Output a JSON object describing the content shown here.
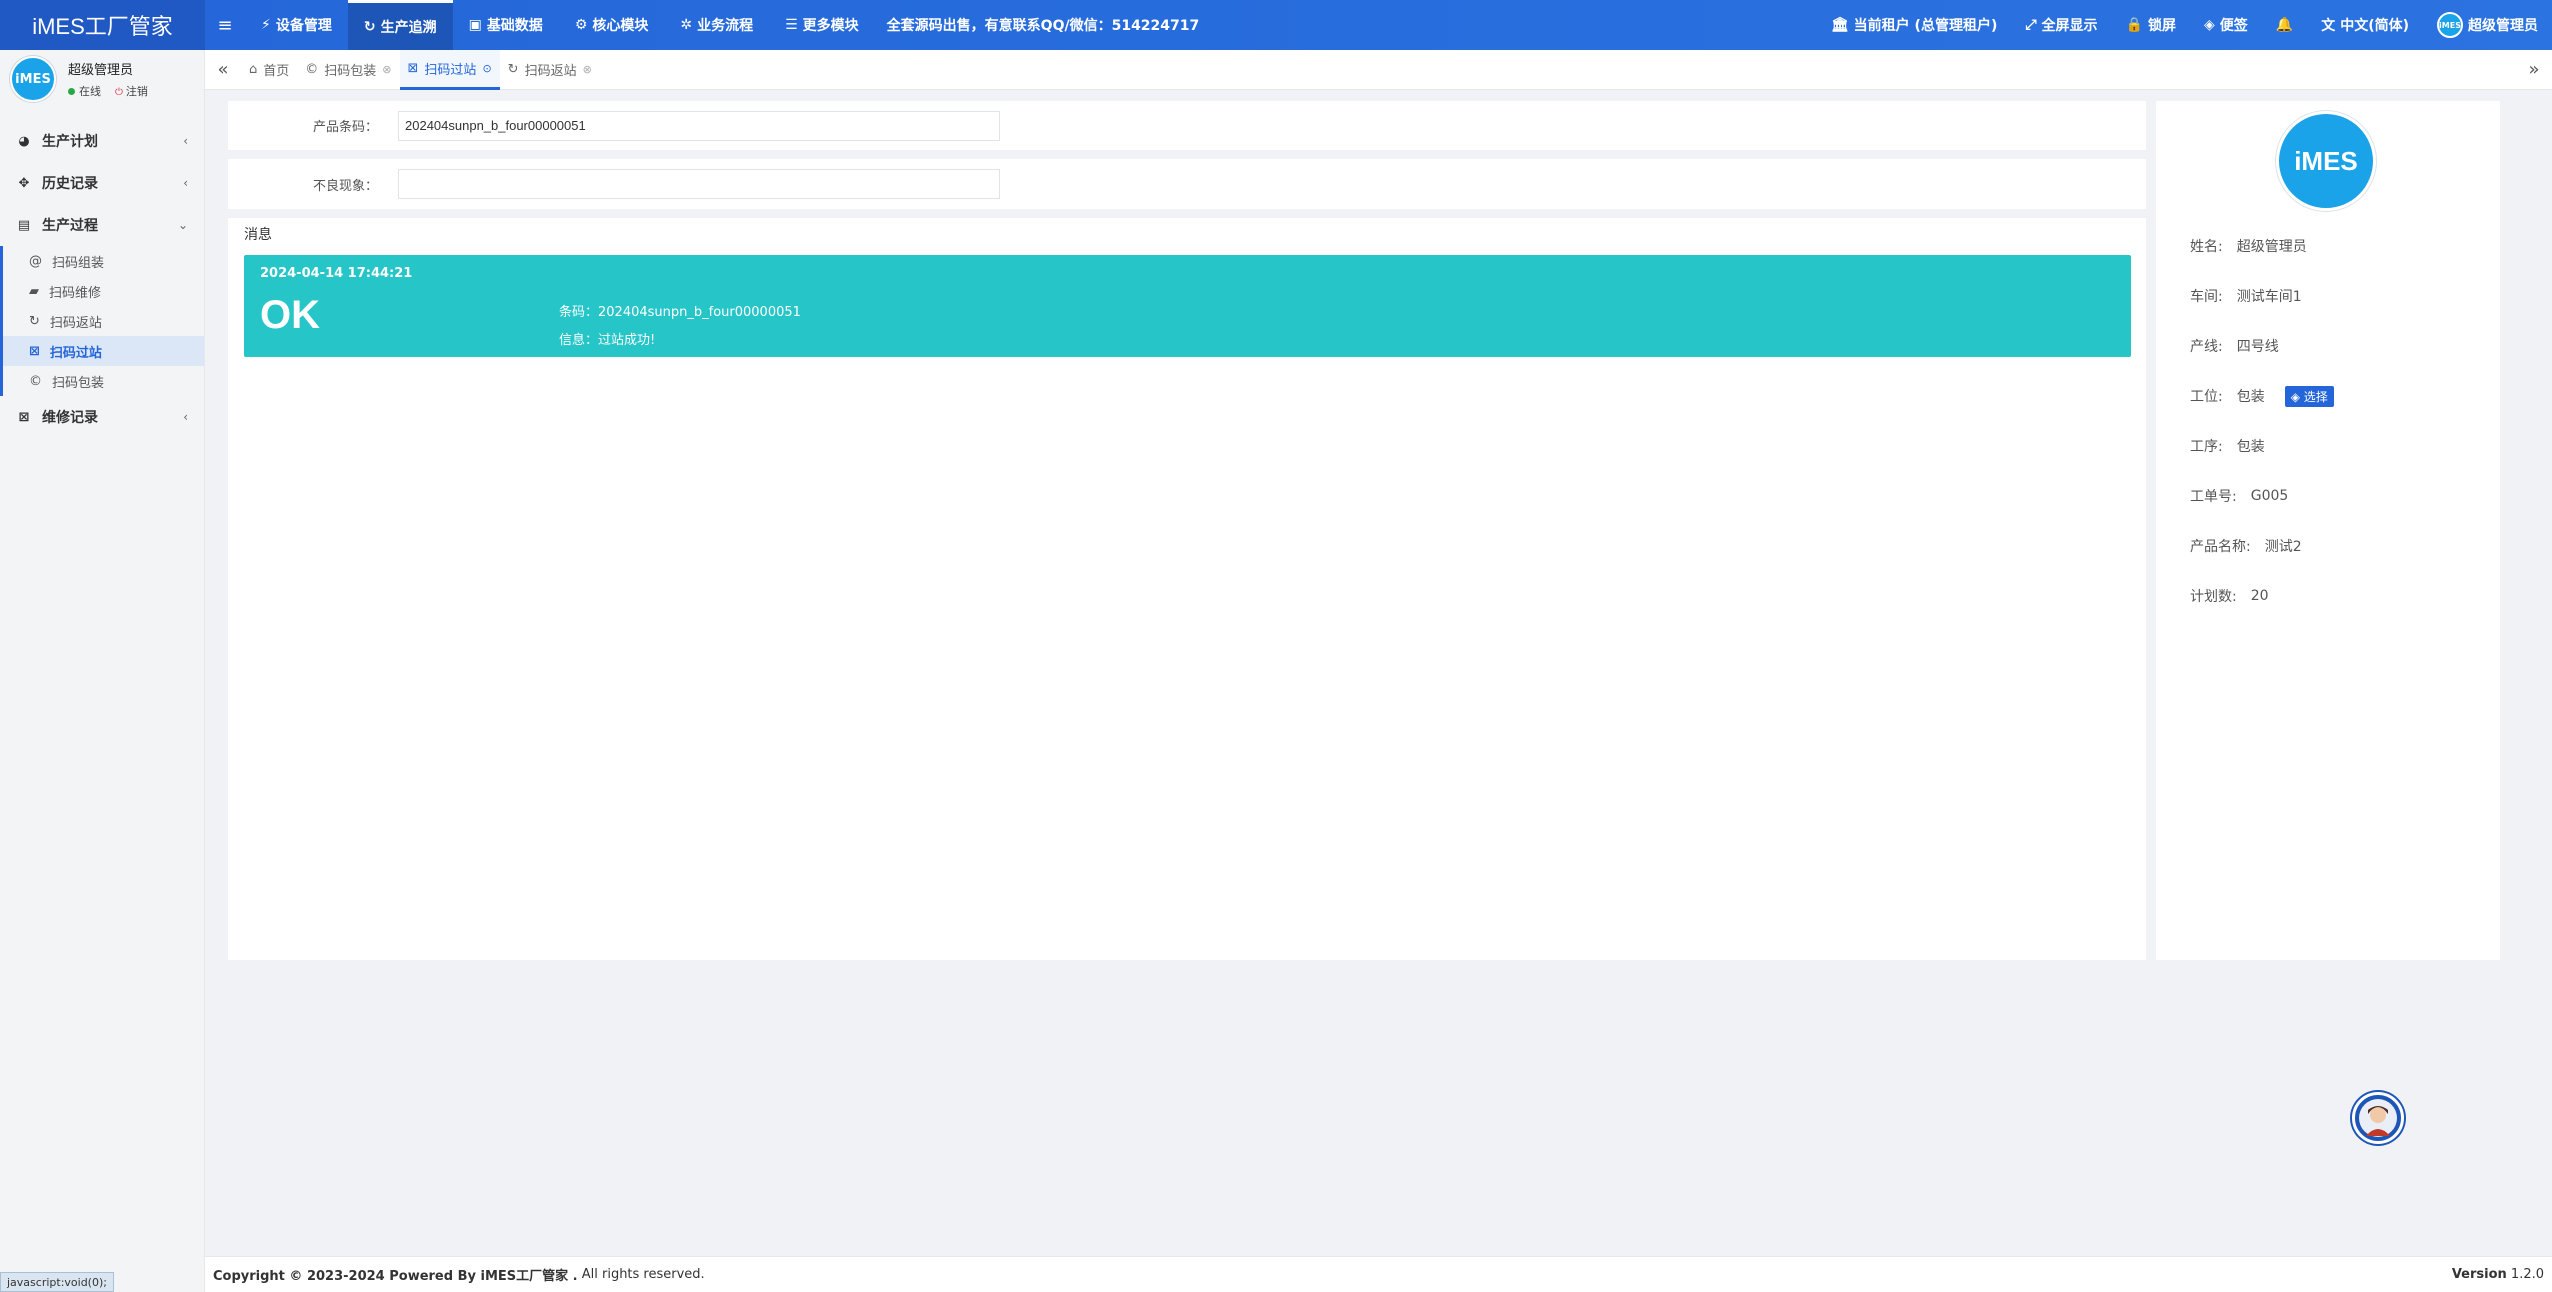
{
  "app": {
    "brand": "iMES工厂管家"
  },
  "topnav": {
    "items": [
      {
        "icon": "wrench-icon",
        "glyph": "⚡",
        "label": "设备管理"
      },
      {
        "icon": "refresh-icon",
        "glyph": "↻",
        "label": "生产追溯",
        "active": true
      },
      {
        "icon": "book-icon",
        "glyph": "▣",
        "label": "基础数据"
      },
      {
        "icon": "gear-icon",
        "glyph": "⚙",
        "label": "核心模块"
      },
      {
        "icon": "cogs-icon",
        "glyph": "✲",
        "label": "业务流程"
      },
      {
        "icon": "list-icon",
        "glyph": "☰",
        "label": "更多模块"
      }
    ],
    "notice": "全套源码出售，有意联系QQ/微信：514224717"
  },
  "topright": {
    "tenant": "当前租户 (总管理租户)",
    "fullscreen": "全屏显示",
    "lock": "锁屏",
    "notes": "便签",
    "language": "中文(简体)",
    "user": "超级管理员",
    "logo_text": "iMES"
  },
  "sidebar": {
    "user_name": "超级管理员",
    "status_online": "在线",
    "status_logout": "注销",
    "avatar_text": "iMES",
    "menu": [
      {
        "label": "生产计划",
        "icon_glyph": "◕"
      },
      {
        "label": "历史记录",
        "icon_glyph": "✥"
      },
      {
        "label": "生产过程",
        "icon_glyph": "▤",
        "expanded": true
      }
    ],
    "submenu": [
      {
        "label": "扫码组装",
        "icon_glyph": "@"
      },
      {
        "label": "扫码维修",
        "icon_glyph": "▰"
      },
      {
        "label": "扫码返站",
        "icon_glyph": "↻"
      },
      {
        "label": "扫码过站",
        "icon_glyph": "⊠",
        "active": true
      },
      {
        "label": "扫码包装",
        "icon_glyph": "©"
      }
    ],
    "menu_after": [
      {
        "label": "维修记录",
        "icon_glyph": "⊠"
      }
    ]
  },
  "tabs": [
    {
      "label": "首页",
      "icon_glyph": "⌂"
    },
    {
      "label": "扫码包装",
      "icon_glyph": "©",
      "closable": true
    },
    {
      "label": "扫码过站",
      "icon_glyph": "⊠",
      "closable": true,
      "active": true
    },
    {
      "label": "扫码返站",
      "icon_glyph": "↻",
      "closable": true
    }
  ],
  "form": {
    "barcode_label": "产品条码：",
    "barcode_value": "202404sunpn_b_four00000051",
    "defect_label": "不良现象：",
    "defect_value": ""
  },
  "message": {
    "title": "消息",
    "time": "2024-04-14 17:44:21",
    "result": "OK",
    "barcode_line": "条码：202404sunpn_b_four00000051",
    "info_line": "信息：过站成功!",
    "color": "#26c5c8"
  },
  "info": {
    "logo_text": "iMES",
    "rows": [
      {
        "k": "姓名:",
        "v": "超级管理员"
      },
      {
        "k": "车间:",
        "v": "测试车间1"
      },
      {
        "k": "产线:",
        "v": "四号线"
      },
      {
        "k": "工位:",
        "v": "包装"
      },
      {
        "k": "工序:",
        "v": "包装"
      },
      {
        "k": "工单号:",
        "v": "G005"
      },
      {
        "k": "产品名称:",
        "v": "测试2"
      },
      {
        "k": "计划数:",
        "v": "20"
      }
    ],
    "select_label": "选择"
  },
  "footer": {
    "copyright": "Copyright © 2023-2024 Powered By iMES工厂管家 .",
    "rights": "All rights reserved.",
    "version_label": "Version",
    "version": "1.2.0"
  },
  "status_url": "javascript:void(0);",
  "colors": {
    "primary": "#2466d9",
    "accent": "#26c5c8"
  }
}
